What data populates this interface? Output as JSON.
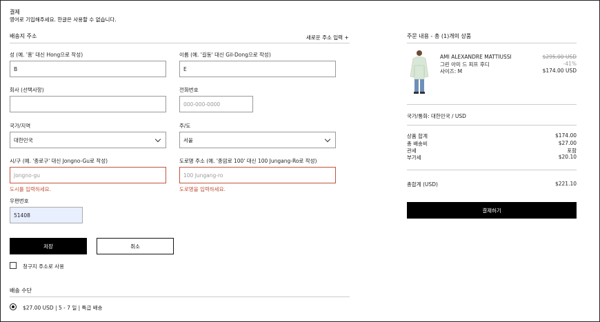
{
  "header": {
    "title": "결제",
    "notice": "영어로 기입해주세요. 한글은 사용할 수 없습니다."
  },
  "shipping": {
    "section_title": "배송지 주소",
    "new_address_link": "새로운 주소 입력 +",
    "last_name": {
      "label": "성 (예. '홍' 대신 Hong으로 작성)",
      "value": "B"
    },
    "first_name": {
      "label": "이름 (예. '길동' 대신 Gil-Dong으로 작성)",
      "value": "E"
    },
    "company": {
      "label": "회사 (선택사항)",
      "value": ""
    },
    "phone": {
      "label": "전화번호",
      "placeholder": "000-000-0000"
    },
    "country": {
      "label": "국가/지역",
      "value": "대한민국"
    },
    "state": {
      "label": "주/도",
      "value": "서울"
    },
    "city": {
      "label": "시/구 (예. '종로구' 대신 Jongno-Gu로 작성)",
      "placeholder": "Jongno-gu",
      "error": "도시를 입력하세요."
    },
    "street": {
      "label": "도로명 주소 (예. '종암로 100' 대신 100 Jungang-Ro로 작성)",
      "placeholder": "100 Jungang-ro",
      "error": "도로명을 입력하세요."
    },
    "postal": {
      "label": "우편번호",
      "value": "51408"
    },
    "save_label": "저장",
    "cancel_label": "취소",
    "billing_checkbox_label": "청구지 주소로 사용"
  },
  "delivery": {
    "section_title": "배송 수단",
    "option_label": "$27.00 USD | 5 - 7 일 | 특급 배송"
  },
  "summary": {
    "title": "주문 내용 - 총 (1)개의 상품",
    "item": {
      "brand": "AMI ALEXANDRE MATTIUSSI",
      "name": "그린 아미 드 피프 후디",
      "size": "사이즈: M",
      "original_price": "$295.00 USD",
      "discount": "-41%",
      "price": "$174.00 USD"
    },
    "country_currency": "국가/통화: 대한민국 / USD",
    "rows": [
      {
        "label": "상품 합계",
        "value": "$174.00"
      },
      {
        "label": "총 배송비",
        "value": "$27.00"
      },
      {
        "label": "관세",
        "value": "포함"
      },
      {
        "label": "부가세",
        "value": "$20.10"
      }
    ],
    "total": {
      "label": "총합계 (USD)",
      "value": "$221.10"
    },
    "pay_label": "결제하기"
  },
  "colors": {
    "error": "#c0533a",
    "primary": "#000000",
    "autofill": "#e8efff"
  }
}
